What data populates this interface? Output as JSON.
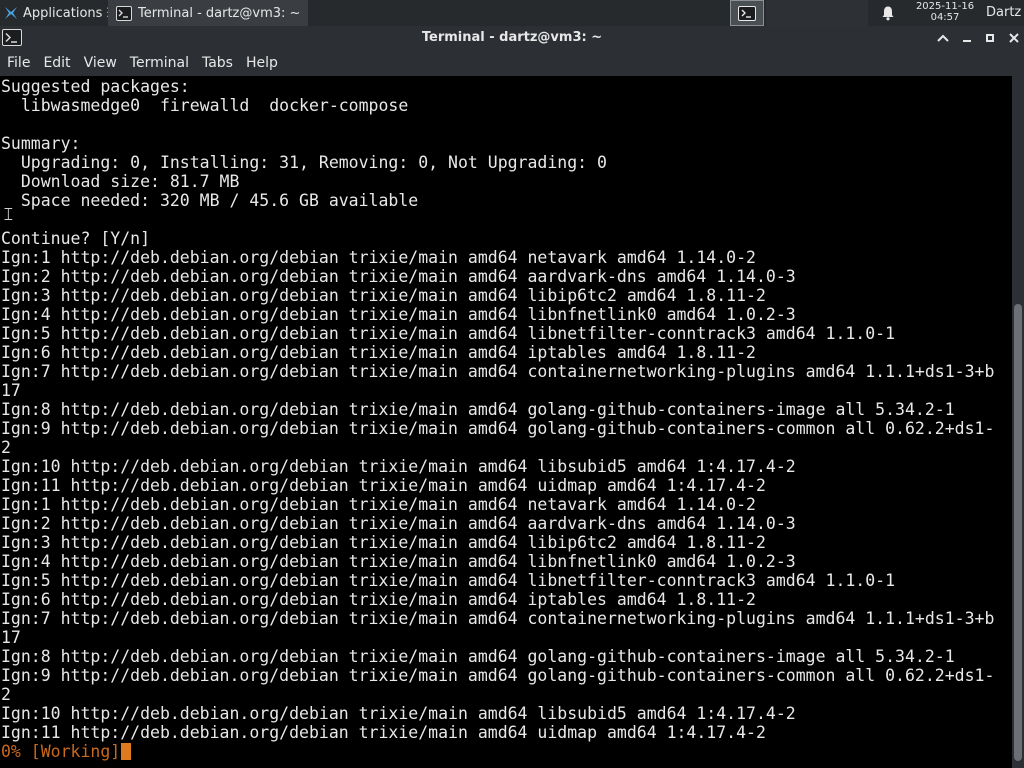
{
  "panel": {
    "applications_label": "Applications",
    "applications_suffix": "☰",
    "task_title": "Terminal - dartz@vm3: ~",
    "clock_date": "2025-11-16",
    "clock_time": "04:57",
    "user": "Dartz"
  },
  "window": {
    "title": "Terminal - dartz@vm3: ~"
  },
  "menu": {
    "items": [
      "File",
      "Edit",
      "View",
      "Terminal",
      "Tabs",
      "Help"
    ]
  },
  "terminal": {
    "lines": [
      "Suggested packages:",
      "  libwasmedge0  firewalld  docker-compose",
      "",
      "Summary:",
      "  Upgrading: 0, Installing: 31, Removing: 0, Not Upgrading: 0",
      "  Download size: 81.7 MB",
      "  Space needed: 320 MB / 45.6 GB available",
      "",
      "Continue? [Y/n]",
      "Ign:1 http://deb.debian.org/debian trixie/main amd64 netavark amd64 1.14.0-2",
      "Ign:2 http://deb.debian.org/debian trixie/main amd64 aardvark-dns amd64 1.14.0-3",
      "Ign:3 http://deb.debian.org/debian trixie/main amd64 libip6tc2 amd64 1.8.11-2",
      "Ign:4 http://deb.debian.org/debian trixie/main amd64 libnfnetlink0 amd64 1.0.2-3",
      "Ign:5 http://deb.debian.org/debian trixie/main amd64 libnetfilter-conntrack3 amd64 1.1.0-1",
      "Ign:6 http://deb.debian.org/debian trixie/main amd64 iptables amd64 1.8.11-2",
      "Ign:7 http://deb.debian.org/debian trixie/main amd64 containernetworking-plugins amd64 1.1.1+ds1-3+b",
      "17",
      "Ign:8 http://deb.debian.org/debian trixie/main amd64 golang-github-containers-image all 5.34.2-1",
      "Ign:9 http://deb.debian.org/debian trixie/main amd64 golang-github-containers-common all 0.62.2+ds1-",
      "2",
      "Ign:10 http://deb.debian.org/debian trixie/main amd64 libsubid5 amd64 1:4.17.4-2",
      "Ign:11 http://deb.debian.org/debian trixie/main amd64 uidmap amd64 1:4.17.4-2",
      "Ign:1 http://deb.debian.org/debian trixie/main amd64 netavark amd64 1.14.0-2",
      "Ign:2 http://deb.debian.org/debian trixie/main amd64 aardvark-dns amd64 1.14.0-3",
      "Ign:3 http://deb.debian.org/debian trixie/main amd64 libip6tc2 amd64 1.8.11-2",
      "Ign:4 http://deb.debian.org/debian trixie/main amd64 libnfnetlink0 amd64 1.0.2-3",
      "Ign:5 http://deb.debian.org/debian trixie/main amd64 libnetfilter-conntrack3 amd64 1.1.0-1",
      "Ign:6 http://deb.debian.org/debian trixie/main amd64 iptables amd64 1.8.11-2",
      "Ign:7 http://deb.debian.org/debian trixie/main amd64 containernetworking-plugins amd64 1.1.1+ds1-3+b",
      "17",
      "Ign:8 http://deb.debian.org/debian trixie/main amd64 golang-github-containers-image all 5.34.2-1",
      "Ign:9 http://deb.debian.org/debian trixie/main amd64 golang-github-containers-common all 0.62.2+ds1-",
      "2",
      "Ign:10 http://deb.debian.org/debian trixie/main amd64 libsubid5 amd64 1:4.17.4-2",
      "Ign:11 http://deb.debian.org/debian trixie/main amd64 uidmap amd64 1:4.17.4-2"
    ],
    "progress_line": "0% [Working]",
    "scroll_thumb_start": 0.33,
    "scroll_thumb_fraction": 0.66
  },
  "colors": {
    "panel_bg": "#262a2d",
    "chrome_bg": "#2c3034",
    "terminal_bg": "#000000",
    "terminal_fg": "#e8e8e8",
    "progress_fg": "#c8691c",
    "cursor": "#e07a1f"
  },
  "icons": [
    "applications-menu-icon",
    "terminal-icon",
    "bell-icon",
    "chevron-up-icon",
    "minimize-icon",
    "maximize-icon",
    "close-icon",
    "text-cursor-icon"
  ]
}
